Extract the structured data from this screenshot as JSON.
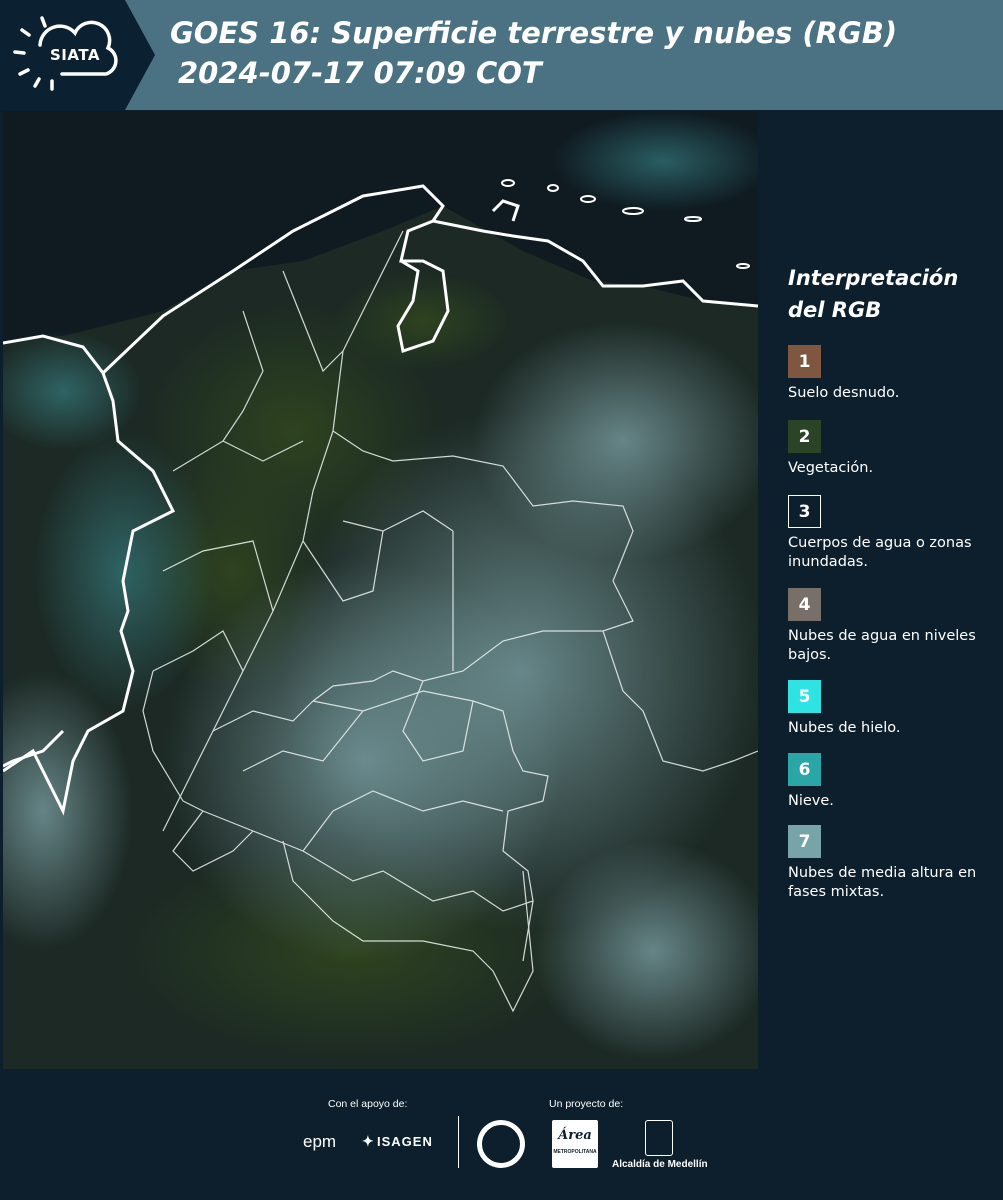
{
  "header": {
    "logo_text": "SIATA",
    "title_line1": "GOES 16: Superficie terrestre y nubes (RGB)",
    "title_line2": "2024-07-17 07:09 COT"
  },
  "legend": {
    "title_line1": "Interpretación",
    "title_line2": "del RGB",
    "items": [
      {
        "number": "1",
        "color": "#7f5740",
        "label": "Suelo desnudo."
      },
      {
        "number": "2",
        "color": "#2b4427",
        "label": "Vegetación."
      },
      {
        "number": "3",
        "color": "#0d1f2c",
        "label": "Cuerpos de agua o zonas inundadas."
      },
      {
        "number": "4",
        "color": "#786f68",
        "label": "Nubes de agua en niveles bajos."
      },
      {
        "number": "5",
        "color": "#2fe3e3",
        "label": "Nubes de hielo."
      },
      {
        "number": "6",
        "color": "#2ba6a6",
        "label": "Nieve."
      },
      {
        "number": "7",
        "color": "#76a4a8",
        "label": "Nubes de media altura en fases mixtas."
      }
    ]
  },
  "footer": {
    "support_label": "Con el apoyo de:",
    "project_label": "Un proyecto de:",
    "sponsor1": "epm",
    "sponsor2": "ISAGEN",
    "area_text": "Área",
    "area_sub": "METROPOLITANA",
    "alcaldia": "Alcaldía de Medellín"
  }
}
